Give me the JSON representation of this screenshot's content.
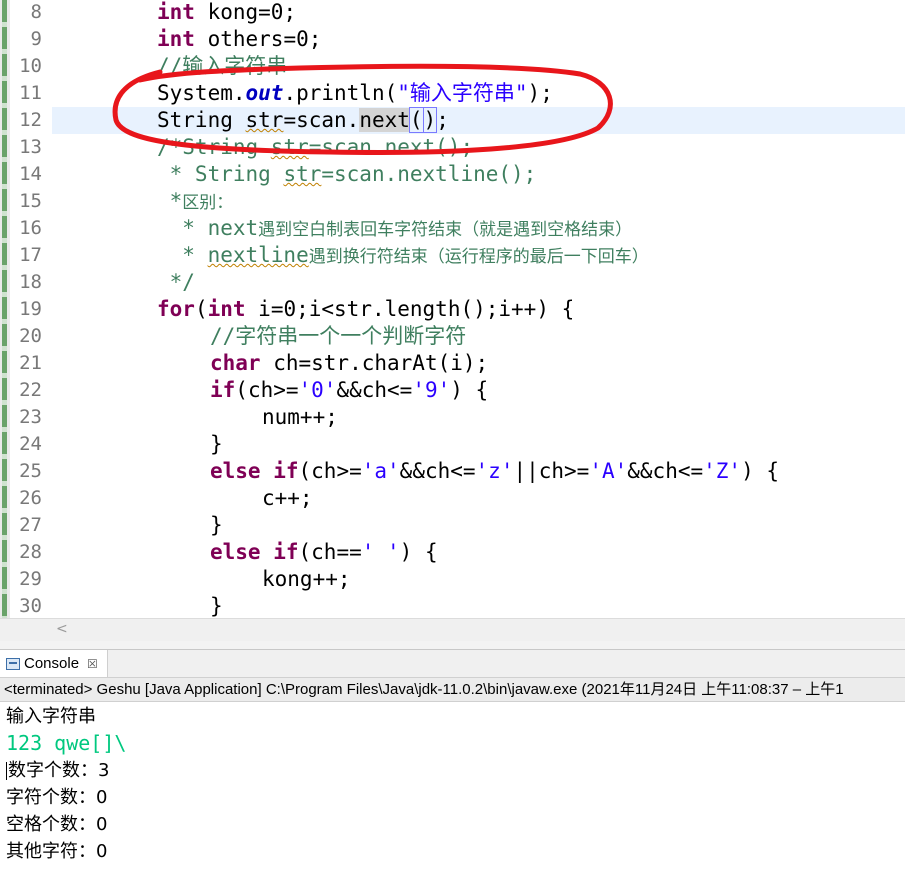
{
  "editor": {
    "line_numbers": [
      "8",
      "9",
      "10",
      "11",
      "12",
      "13",
      "14",
      "15",
      "16",
      "17",
      "18",
      "19",
      "20",
      "21",
      "22",
      "23",
      "24",
      "25",
      "26",
      "27",
      "28",
      "29",
      "30"
    ],
    "l8": {
      "kw": "int",
      "rest": " kong=0;"
    },
    "l9": {
      "kw": "int",
      "rest": " others=0;"
    },
    "l10": {
      "comment": "//输入字符串"
    },
    "l11": {
      "a": "System.",
      "field": "out",
      "b": ".println(",
      "str": "\"输入字符串\"",
      "c": ");"
    },
    "l12": {
      "a": "String ",
      "var": "str",
      "b": "=scan.",
      "method": "next",
      "c": "(",
      "d": ")",
      "e": ";"
    },
    "l13": {
      "a": "/*String ",
      "var": "str",
      "b": "=scan.next();"
    },
    "l14": {
      "a": " * String ",
      "var": "str",
      "b": "=scan.nextline();"
    },
    "l15": {
      "a": " *",
      "cjk": "区别："
    },
    "l16": {
      "a": "  * next",
      "cjk": "遇到空白制表回车字符结束（就是遇到空格结束）"
    },
    "l17": {
      "a": "  * ",
      "sq": "nextline",
      "cjk": "遇到换行符结束（运行程序的最后一下回车）"
    },
    "l18": {
      "a": " */"
    },
    "l19": {
      "kw": "for",
      "a": "(",
      "kw2": "int",
      "b": " i=0;i<str.length();i++) {"
    },
    "l20": {
      "comment": "//字符串一个一个判断字符"
    },
    "l21": {
      "kw": "char",
      "rest": " ch=str.charAt(i);"
    },
    "l22": {
      "kw": "if",
      "a": "(ch>=",
      "s1": "'0'",
      "b": "&&ch<=",
      "s2": "'9'",
      "c": ") {"
    },
    "l23": {
      "rest": "num++;"
    },
    "l24": {
      "rest": "}"
    },
    "l25": {
      "kw": "else",
      "kw2": " if",
      "a": "(ch>=",
      "s1": "'a'",
      "b": "&&ch<=",
      "s2": "'z'",
      "c": "||ch>=",
      "s3": "'A'",
      "d": "&&ch<=",
      "s4": "'Z'",
      "e": ") {"
    },
    "l26": {
      "rest": "c++;"
    },
    "l27": {
      "rest": "}"
    },
    "l28": {
      "kw": "else",
      "kw2": " if",
      "a": "(ch==",
      "s1": "' '",
      "b": ") {"
    },
    "l29": {
      "rest": "kong++;"
    },
    "l30": {
      "rest": "}"
    }
  },
  "scroll": {
    "left_arrow": "<"
  },
  "console": {
    "tab_label": "Console",
    "tab_close": "☒",
    "status": "<terminated> Geshu [Java Application] C:\\Program Files\\Java\\jdk-11.0.2\\bin\\javaw.exe  (2021年11月24日 上午11:08:37 – 上午1",
    "lines": [
      "输入字符串",
      "123   qwe[]\\",
      "数字个数：3",
      "字符个数：0",
      "空格个数：0",
      "其他字符：0"
    ]
  },
  "colors": {
    "keyword": "#7f0055",
    "comment": "#3f7f5f",
    "string": "#2a00ff",
    "input": "#00c87f",
    "annotation": "#e8161b"
  }
}
